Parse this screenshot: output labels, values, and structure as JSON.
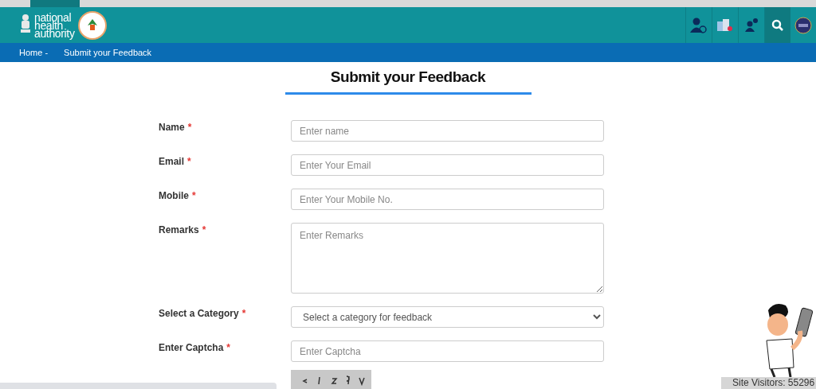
{
  "header": {
    "logo_text": [
      "national",
      "health",
      "authority"
    ]
  },
  "breadcrumb": [
    "Home -",
    "Submit your Feedback"
  ],
  "title": "Submit your Feedback",
  "fields": [
    {
      "kind": "input",
      "label": "Name",
      "placeholder": "Enter name"
    },
    {
      "kind": "input",
      "label": "Email",
      "placeholder": "Enter Your Email"
    },
    {
      "kind": "input",
      "label": "Mobile",
      "placeholder": "Enter Your Mobile No."
    },
    {
      "kind": "textarea",
      "label": "Remarks",
      "placeholder": "Enter Remarks"
    },
    {
      "kind": "select",
      "label": "Select a Category",
      "value": "Select a category for feedback"
    },
    {
      "kind": "input",
      "label": "Enter Captcha",
      "placeholder": "Enter Captcha"
    }
  ],
  "required_mark": "*",
  "site_visitors": "Site Visitors: 55296"
}
